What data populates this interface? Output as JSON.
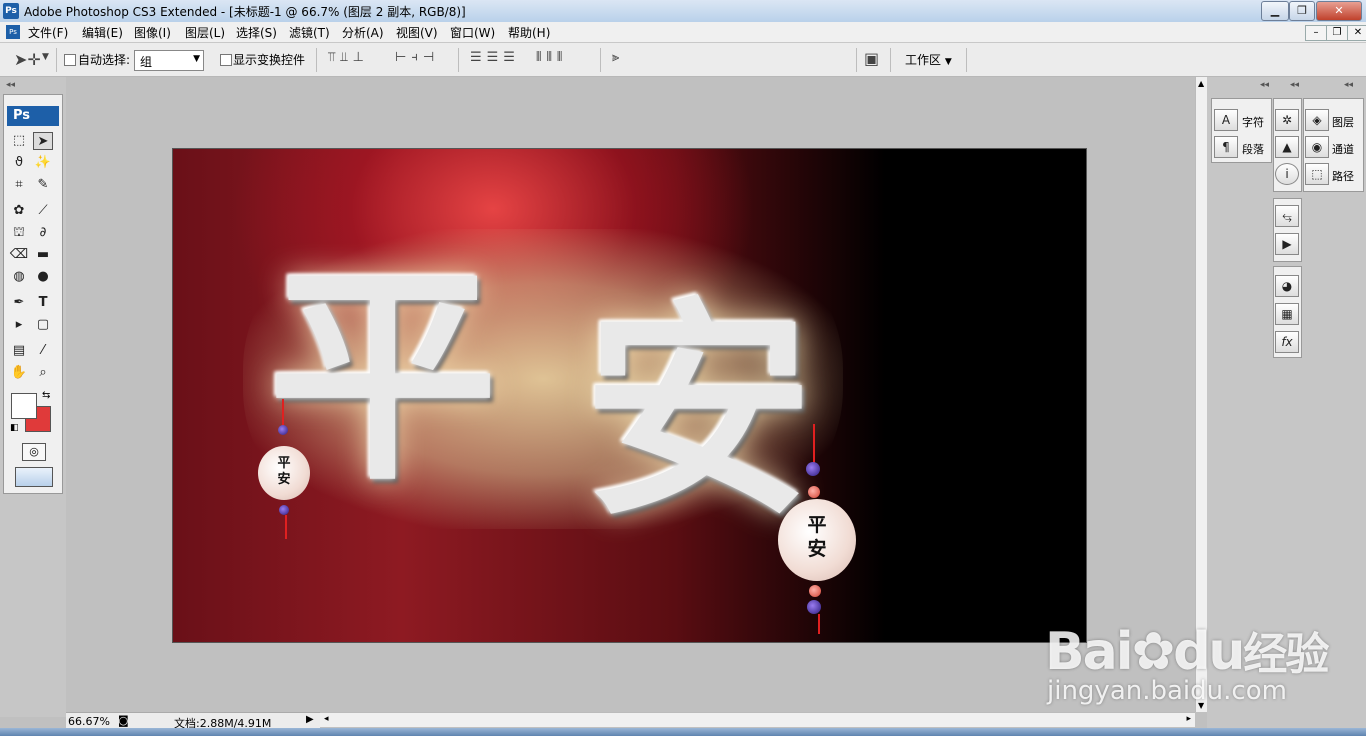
{
  "window": {
    "app_title": "Adobe Photoshop CS3 Extended - [未标题-1 @ 66.7% (图层 2 副本, RGB/8)]",
    "ps_badge": "Ps"
  },
  "menu": [
    "文件(F)",
    "编辑(E)",
    "图像(I)",
    "图层(L)",
    "选择(S)",
    "滤镜(T)",
    "分析(A)",
    "视图(V)",
    "窗口(W)",
    "帮助(H)"
  ],
  "options": {
    "auto_select_label": "自动选择:",
    "auto_select_value": "组",
    "show_transform_label": "显示变换控件",
    "workspace_label": "工作区"
  },
  "canvas": {
    "big_text_1": "平",
    "big_text_2": "安",
    "lantern_text_1": "平",
    "lantern_text_2": "安"
  },
  "status": {
    "zoom": "66.67%",
    "doc_info": "文档:2.88M/4.91M"
  },
  "panels": {
    "char_label": "字符",
    "para_label": "段落",
    "layers_label": "图层",
    "channels_label": "通道",
    "paths_label": "路径"
  },
  "watermark": {
    "brand": "Bai",
    "brand2": "du",
    "jingyan": "经验",
    "url": "jingyan.baidu.com"
  },
  "colors": {
    "foreground": "#ffffff",
    "background": "#e03a3a"
  }
}
